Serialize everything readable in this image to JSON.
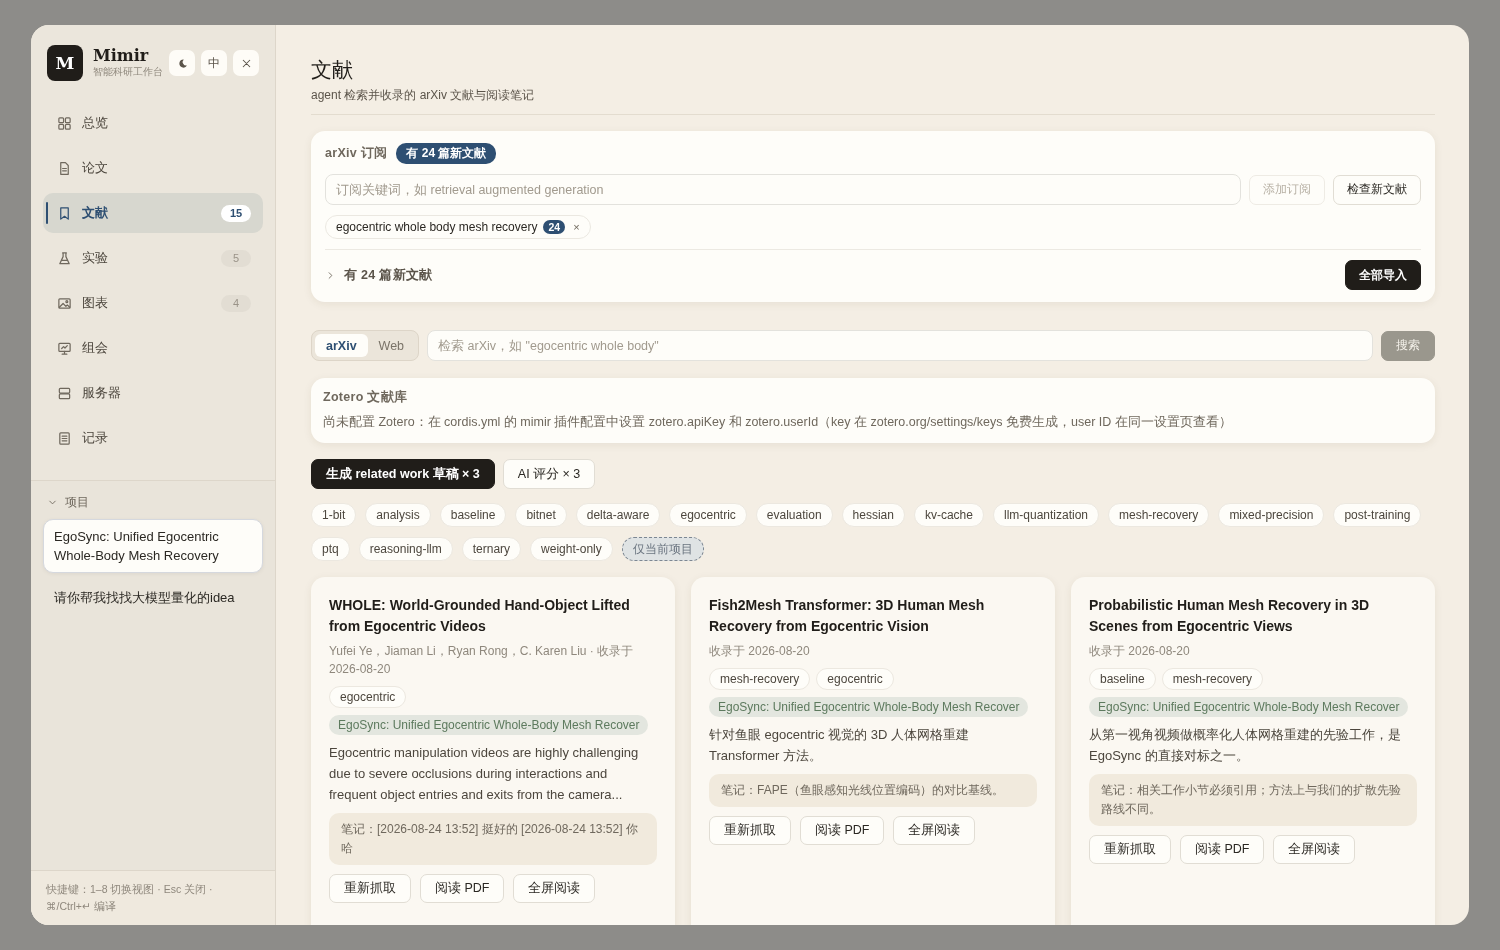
{
  "app": {
    "logo": "M",
    "name": "Mimir",
    "subtitle": "智能科研工作台",
    "lang_button": "中"
  },
  "sidebar": {
    "items": [
      {
        "label": "总览",
        "selected": false
      },
      {
        "label": "论文",
        "selected": false
      },
      {
        "label": "文献",
        "selected": true,
        "count": "15"
      },
      {
        "label": "实验",
        "selected": false,
        "count": "5"
      },
      {
        "label": "图表",
        "selected": false,
        "count": "4"
      },
      {
        "label": "组会",
        "selected": false
      },
      {
        "label": "服务器",
        "selected": false
      },
      {
        "label": "记录",
        "selected": false
      }
    ],
    "projects": {
      "title": "项目",
      "expanded": true,
      "items": [
        {
          "label": "EgoSync: Unified Egocentric Whole-Body Mesh Recovery",
          "selected": true
        },
        {
          "label": "请你帮我找找大模型量化的idea",
          "selected": false
        }
      ]
    },
    "footer": "快捷键：1–8 切换视图 · Esc 关闭 · ⌘/Ctrl+↵ 编译"
  },
  "page": {
    "title": "文献",
    "subtitle": "agent 检索并收录的 arXiv 文献与阅读笔记"
  },
  "subscription": {
    "title": "arXiv 订阅",
    "badge": "有 24 篇新文献",
    "placeholder": "订阅关键词，如 retrieval augmented generation",
    "buttons": [
      {
        "label": "添加订阅",
        "disabled": true
      },
      {
        "label": "检查新文献",
        "disabled": false
      }
    ],
    "chips": [
      {
        "label": "egocentric whole body mesh recovery",
        "count": "24",
        "remove": "×"
      }
    ],
    "new_section": {
      "label": "有 24 篇新文献",
      "expanded": false,
      "button": "全部导入"
    }
  },
  "search": {
    "sources": [
      {
        "label": "arXiv",
        "selected": true
      },
      {
        "label": "Web",
        "selected": false
      }
    ],
    "placeholder": "检索 arXiv，如 \"egocentric whole body\"",
    "button": {
      "label": "搜索",
      "disabled": true
    }
  },
  "zotero": {
    "title": "Zotero 文献库",
    "message": "尚未配置 Zotero：在 cordis.yml 的 mimir 插件配置中设置 zotero.apiKey 和 zotero.userId（key 在 zotero.org/settings/keys 免费生成，user ID 在同一设置页查看）"
  },
  "actions": [
    {
      "label": "生成 related work 草稿 × 3",
      "kind": "primary"
    },
    {
      "label": "AI 评分 × 3",
      "kind": "secondary"
    }
  ],
  "filters": [
    {
      "label": "1-bit",
      "kind": "tag",
      "selected": false
    },
    {
      "label": "analysis",
      "kind": "tag",
      "selected": false
    },
    {
      "label": "baseline",
      "kind": "tag",
      "selected": false
    },
    {
      "label": "bitnet",
      "kind": "tag",
      "selected": false
    },
    {
      "label": "delta-aware",
      "kind": "tag",
      "selected": false
    },
    {
      "label": "egocentric",
      "kind": "tag",
      "selected": false
    },
    {
      "label": "evaluation",
      "kind": "tag",
      "selected": false
    },
    {
      "label": "hessian",
      "kind": "tag",
      "selected": false
    },
    {
      "label": "kv-cache",
      "kind": "tag",
      "selected": false
    },
    {
      "label": "llm-quantization",
      "kind": "tag",
      "selected": false
    },
    {
      "label": "mesh-recovery",
      "kind": "tag",
      "selected": false
    },
    {
      "label": "mixed-precision",
      "kind": "tag",
      "selected": false
    },
    {
      "label": "post-training",
      "kind": "tag",
      "selected": false
    },
    {
      "label": "ptq",
      "kind": "tag",
      "selected": false
    },
    {
      "label": "reasoning-llm",
      "kind": "tag",
      "selected": false
    },
    {
      "label": "ternary",
      "kind": "tag",
      "selected": false
    },
    {
      "label": "weight-only",
      "kind": "tag",
      "selected": false
    },
    {
      "label": "仅当前项目",
      "kind": "scope",
      "selected": false
    }
  ],
  "papers": [
    {
      "title": "WHOLE: World-Grounded Hand-Object Lifted from Egocentric Videos",
      "meta": "Yufei Ye，Jiaman Li，Ryan Rong，C. Karen Liu · 收录于 2026-08-20",
      "tags": [
        "egocentric"
      ],
      "project": "EgoSync: Unified Egocentric Whole-Body Mesh Recover",
      "summary": "Egocentric manipulation videos are highly challenging due to severe occlusions during interactions and frequent object entries and exits from the camera...",
      "note": "笔记：[2026-08-24 13:52] 挺好的 [2026-08-24 13:52] 你哈",
      "buttons": [
        "重新抓取",
        "阅读 PDF",
        "全屏阅读"
      ]
    },
    {
      "title": "Fish2Mesh Transformer: 3D Human Mesh Recovery from Egocentric Vision",
      "meta": "收录于 2026-08-20",
      "tags": [
        "mesh-recovery",
        "egocentric"
      ],
      "project": "EgoSync: Unified Egocentric Whole-Body Mesh Recover",
      "summary": "针对鱼眼 egocentric 视觉的 3D 人体网格重建 Transformer 方法。",
      "note": "笔记：FAPE（鱼眼感知光线位置编码）的对比基线。",
      "buttons": [
        "重新抓取",
        "阅读 PDF",
        "全屏阅读"
      ]
    },
    {
      "title": "Probabilistic Human Mesh Recovery in 3D Scenes from Egocentric Views",
      "meta": "收录于 2026-08-20",
      "tags": [
        "baseline",
        "mesh-recovery"
      ],
      "project": "EgoSync: Unified Egocentric Whole-Body Mesh Recover",
      "summary": "从第一视角视频做概率化人体网格重建的先验工作，是 EgoSync 的直接对标之一。",
      "note": "笔记：相关工作小节必须引用；方法上与我们的扩散先验路线不同。",
      "buttons": [
        "重新抓取",
        "阅读 PDF",
        "全屏阅读"
      ]
    }
  ]
}
